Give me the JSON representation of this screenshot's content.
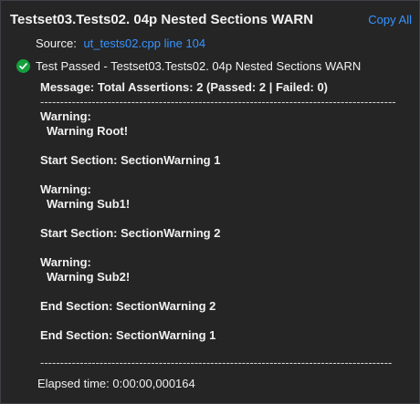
{
  "header": {
    "title": "Testset03.Tests02. 04p Nested Sections WARN",
    "copy_all_label": "Copy All"
  },
  "source": {
    "label": "Source:",
    "link": "ut_tests02.cpp line 104"
  },
  "status": {
    "icon": "check-circle-icon",
    "color": "#14a03c",
    "text": "Test Passed - Testset03.Tests02. 04p Nested Sections WARN"
  },
  "output": {
    "message": "Message: Total Assertions: 2 (Passed: 2 | Failed: 0)",
    "separator": "-----------------------------------------------------------------------------------------------------------",
    "lines": [
      "Warning:",
      "Warning Root!",
      "Start Section: SectionWarning 1",
      "Warning:",
      "Warning Sub1!",
      "Start Section: SectionWarning 2",
      "Warning:",
      "Warning Sub2!",
      "End Section: SectionWarning 2",
      "End Section: SectionWarning 1"
    ]
  },
  "elapsed": "Elapsed time: 0:00:00,000164"
}
